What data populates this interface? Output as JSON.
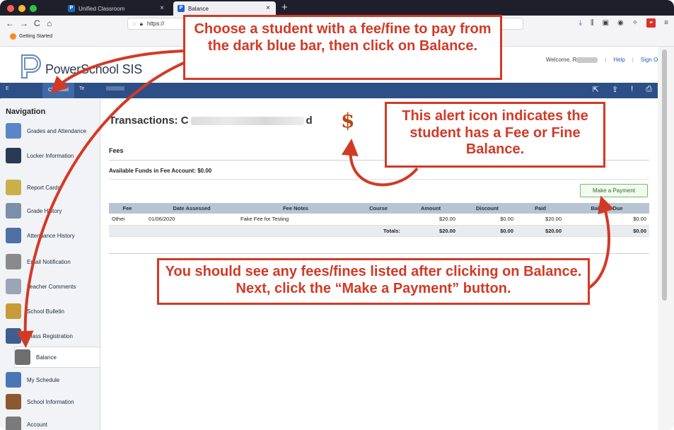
{
  "browser": {
    "tabs": [
      {
        "label": "Unified Classroom",
        "active": false
      },
      {
        "label": "Balance",
        "active": true
      }
    ],
    "new_tab": "+",
    "tab_close": "×",
    "url": "https://",
    "bookmark": "Getting Started",
    "nav": {
      "back": "←",
      "forward": "→",
      "reload": "C",
      "home": "⌂"
    }
  },
  "header": {
    "app_name": "PowerSchool SIS",
    "welcome": "Welcome, R",
    "help": "Help",
    "sign_out": "Sign Out"
  },
  "bluebar": {
    "tabs": [
      "E",
      "Cl",
      "Te",
      ""
    ],
    "selected_index": 1
  },
  "sidebar": {
    "title": "Navigation",
    "items": [
      {
        "label": "Grades and Attendance",
        "icon": "grades-icon"
      },
      {
        "label": "Locker Information",
        "icon": "locker-icon"
      },
      {
        "label": "Report Cards",
        "icon": "report-cards-icon"
      },
      {
        "label": "Grade History",
        "icon": "grade-history-icon"
      },
      {
        "label": "Attendance History",
        "icon": "attendance-history-icon"
      },
      {
        "label": "Email Notification",
        "icon": "email-icon"
      },
      {
        "label": "Teacher Comments",
        "icon": "comments-icon"
      },
      {
        "label": "School Bulletin",
        "icon": "bulletin-icon"
      },
      {
        "label": "Class Registration",
        "icon": "registration-icon"
      },
      {
        "label": "Balance",
        "icon": "balance-icon",
        "selected": true
      },
      {
        "label": "My Schedule",
        "icon": "schedule-icon"
      },
      {
        "label": "School Information",
        "icon": "school-icon"
      },
      {
        "label": "Account",
        "icon": "account-icon"
      }
    ]
  },
  "main": {
    "title_prefix": "Transactions: C",
    "title_suffix": "d",
    "alert_symbol": "$",
    "fees_heading": "Fees",
    "available_funds": "Available Funds in Fee Account: $0.00",
    "pay_button": "Make a Payment",
    "table": {
      "headers": [
        "Fee",
        "Date Assessed",
        "Fee Notes",
        "Course",
        "Amount",
        "Discount",
        "Paid",
        "Balance Due"
      ],
      "rows": [
        [
          "Other",
          "01/06/2020",
          "Fake Fee for Testing",
          "",
          "$20.00",
          "$0.00",
          "$20.00",
          "$0.00"
        ]
      ],
      "totals_label": "Totals:",
      "totals": [
        "$20.00",
        "$0.00",
        "$20.00",
        "$0.00"
      ]
    }
  },
  "callouts": {
    "top": "Choose a student with a fee/fine to pay from the dark blue bar, then click on Balance.",
    "right": "This alert icon indicates the student has a Fee or Fine Balance.",
    "bottom": "You should see any fees/fines listed after clicking on Balance.  Next, click the “Make a Payment” button."
  },
  "colors": {
    "callout_red": "#d23a26",
    "nav_blue": "#2c4f86",
    "pay_green": "#6dbd61"
  }
}
